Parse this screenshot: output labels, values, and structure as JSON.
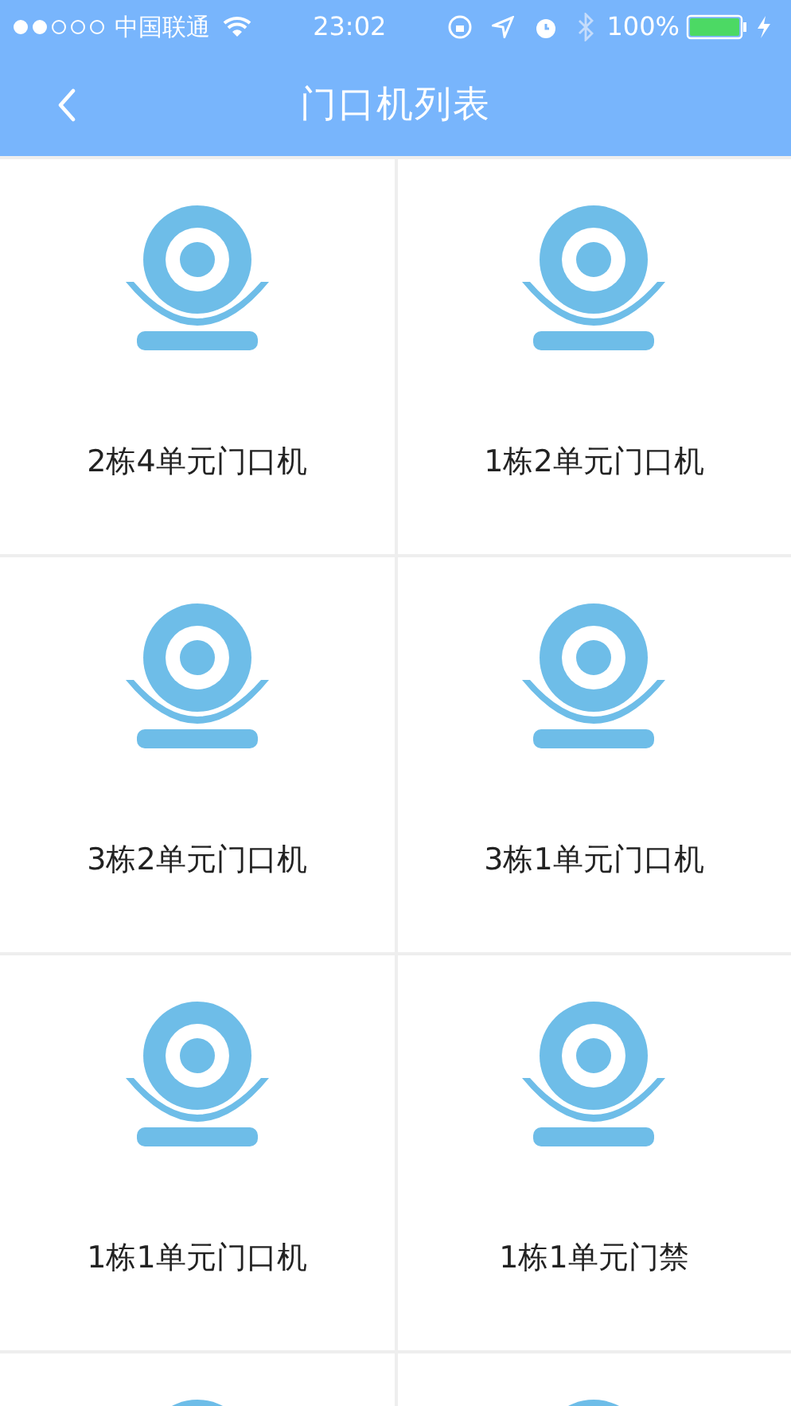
{
  "status_bar": {
    "carrier": "中国联通",
    "time": "23:02",
    "battery": "100%"
  },
  "nav": {
    "title": "门口机列表"
  },
  "devices": [
    {
      "kind": "door-camera",
      "label": "2栋4单元门口机"
    },
    {
      "kind": "door-camera",
      "label": "1栋2单元门口机"
    },
    {
      "kind": "door-camera",
      "label": "3栋2单元门口机"
    },
    {
      "kind": "door-camera",
      "label": "3栋1单元门口机"
    },
    {
      "kind": "door-camera",
      "label": "1栋1单元门口机"
    },
    {
      "kind": "door-camera",
      "label": "1栋1单元门禁"
    },
    {
      "kind": "door-camera"
    },
    {
      "kind": "door-camera"
    }
  ]
}
